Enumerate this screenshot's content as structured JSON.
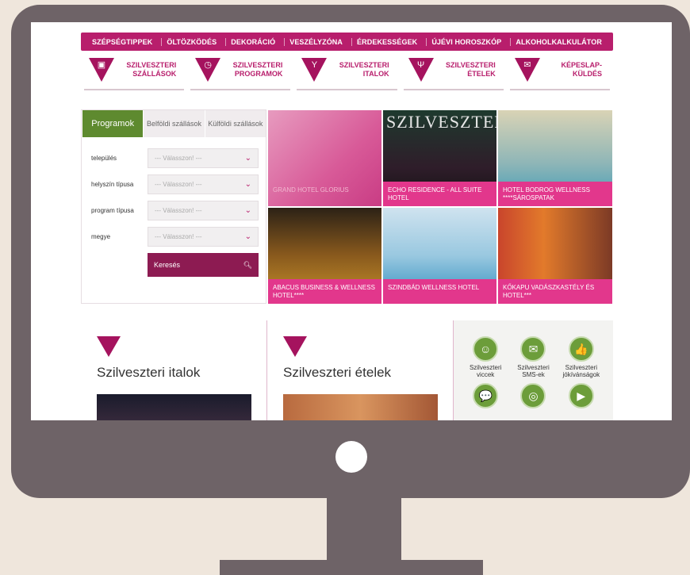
{
  "topnav": [
    "SZÉPSÉGTIPPEK",
    "ÖLTÖZKÖDÉS",
    "DEKORÁCIÓ",
    "VESZÉLYZÓNA",
    "ÉRDEKESSÉGEK",
    "ÚJÉVI HOROSZKÓP",
    "ALKOHOLKALKULÁTOR"
  ],
  "categories": [
    {
      "line1": "SZILVESZTERI",
      "line2": "SZÁLLÁSOK",
      "icon": "suitcase-icon"
    },
    {
      "line1": "SZILVESZTERI",
      "line2": "PROGRAMOK",
      "icon": "clock-icon"
    },
    {
      "line1": "SZILVESZTERI",
      "line2": "ITALOK",
      "icon": "cocktail-icon"
    },
    {
      "line1": "SZILVESZTERI",
      "line2": "ÉTELEK",
      "icon": "food-icon"
    },
    {
      "line1": "KÉPESLAP-",
      "line2": "KÜLDÉS",
      "icon": "postcard-icon"
    }
  ],
  "tabs": [
    {
      "label": "Programok"
    },
    {
      "label": "Belföldi szállások"
    },
    {
      "label": "Külföldi szállások"
    }
  ],
  "form": {
    "fields": [
      {
        "label": "település",
        "value": "--- Válasszon! ---"
      },
      {
        "label": "helyszín típusa",
        "value": "--- Válasszon! ---"
      },
      {
        "label": "program típusa",
        "value": "--- Válasszon! ---"
      },
      {
        "label": "megye",
        "value": "--- Válasszon! ---"
      }
    ],
    "search": "Keresés"
  },
  "tiles": [
    {
      "caption": "GRAND HOTEL GLORIUS"
    },
    {
      "caption": "ECHO RESIDENCE - ALL SUITE HOTEL",
      "overlay": "SZILVESZTER"
    },
    {
      "caption": "HOTEL BODROG WELLNESS ****SÁROSPATAK"
    },
    {
      "caption": "ABACUS BUSINESS & WELLNESS HOTEL****"
    },
    {
      "caption": "SZINDBÁD WELLNESS HOTEL"
    },
    {
      "caption": "KŐKAPU VADÁSZKASTÉLY ÉS HOTEL***"
    }
  ],
  "sections": [
    {
      "title": "Szilveszteri italok"
    },
    {
      "title": "Szilveszteri ételek"
    }
  ],
  "icons": [
    {
      "label": "Szilveszteri viccek",
      "glyph": "☺"
    },
    {
      "label": "Szilveszteri SMS-ek",
      "glyph": "✉"
    },
    {
      "label": "Szilveszteri jókívánságok",
      "glyph": "👍"
    },
    {
      "label": "",
      "glyph": "💬"
    },
    {
      "label": "",
      "glyph": "◎"
    },
    {
      "label": "",
      "glyph": "▶"
    }
  ],
  "colors": {
    "accent": "#b81e6c",
    "green": "#5e8a2f",
    "monitor": "#6e6367",
    "background": "#efe6dc"
  }
}
